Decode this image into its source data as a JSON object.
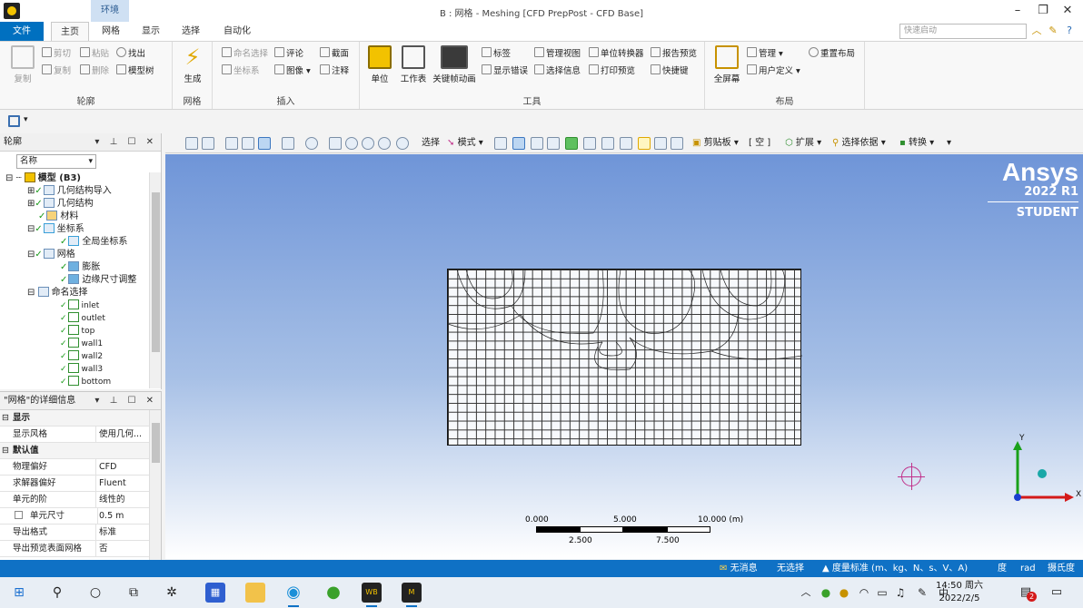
{
  "title_bar": {
    "context_tab": "环境",
    "window_title": "B : 网格 - Meshing [CFD PrepPost - CFD Base]",
    "minimize": "–",
    "maximize": "❐",
    "close": "✕"
  },
  "ribbon_tabs": {
    "file": "文件",
    "items": [
      "主页",
      "网格",
      "显示",
      "选择",
      "自动化"
    ],
    "quick_launch_placeholder": "快速启动"
  },
  "ribbon": {
    "outline_group": {
      "label": "轮廓",
      "copy": "复制",
      "cut": "剪切",
      "paste": "粘贴",
      "find": "找出",
      "duplicate": "复制",
      "delete": "删除",
      "tree": "模型树"
    },
    "mesh_group": {
      "label": "网格",
      "generate": "生成"
    },
    "insert_group": {
      "label": "插入",
      "named_selection": "命名选择",
      "comment": "评论",
      "section": "截面",
      "coordinate_system": "坐标系",
      "image": "图像",
      "annotation": "注释"
    },
    "tools_group": {
      "label": "工具",
      "units": "单位",
      "worksheet": "工作表",
      "keyframe": "关键帧动画",
      "tags": "标签",
      "show_errors": "显示错误",
      "manage_views": "管理视图",
      "selection_info": "选择信息",
      "unit_converter": "单位转换器",
      "print_preview": "打印预览",
      "report_preview": "报告预览",
      "shortcuts": "快捷键"
    },
    "layout_group": {
      "label": "布局",
      "fullscreen": "全屏幕",
      "manage": "管理",
      "user_defined": "用户定义",
      "reset_layout": "重置布局"
    }
  },
  "outline": {
    "title": "轮廓",
    "filter_value": "名称",
    "tree": [
      {
        "label": "模型 (B3)",
        "bold": true
      },
      {
        "label": "几何结构导入"
      },
      {
        "label": "几何结构"
      },
      {
        "label": "材料"
      },
      {
        "label": "坐标系"
      },
      {
        "label": "全局坐标系"
      },
      {
        "label": "网格"
      },
      {
        "label": "膨胀"
      },
      {
        "label": "边缘尺寸调整"
      },
      {
        "label": "命名选择"
      },
      {
        "label": "inlet"
      },
      {
        "label": "outlet"
      },
      {
        "label": "top"
      },
      {
        "label": "wall1"
      },
      {
        "label": "wall2"
      },
      {
        "label": "wall3"
      },
      {
        "label": "bottom"
      }
    ]
  },
  "details": {
    "title": "\"网格\"的详细信息",
    "sections": [
      {
        "name": "显示",
        "rows": [
          {
            "k": "显示风格",
            "v": "使用几何..."
          }
        ]
      },
      {
        "name": "默认值",
        "rows": [
          {
            "k": "物理偏好",
            "v": "CFD"
          },
          {
            "k": "求解器偏好",
            "v": "Fluent"
          },
          {
            "k": "单元的阶",
            "v": "线性的"
          },
          {
            "k": "单元尺寸",
            "v": "0.5 m",
            "checkbox": true
          },
          {
            "k": "导出格式",
            "v": "标准"
          },
          {
            "k": "导出预览表面网格",
            "v": "否"
          }
        ]
      }
    ]
  },
  "viewport_toolbar": {
    "select": "选择",
    "mode": "模式",
    "clipboard": "剪贴板",
    "empty": "[ 空 ]",
    "extend": "扩展",
    "select_by": "选择依据",
    "convert": "转换"
  },
  "viewport": {
    "brand": "Ansys",
    "version": "2022 R1",
    "edition": "STUDENT",
    "scale_labels_top": [
      "0.000",
      "5.000",
      "10.000 (m)"
    ],
    "scale_labels_bottom": [
      "2.500",
      "7.500"
    ],
    "axis_x": "X",
    "axis_y": "Y"
  },
  "status_bar": {
    "messages": "无消息",
    "selection": "无选择",
    "units": "度量标准 (m、kg、N、s、V、A)",
    "angle": "度",
    "rad": "rad",
    "temp": "摄氏度"
  },
  "taskbar": {
    "ime": "中",
    "time": "14:50 周六",
    "date": "2022/2/5",
    "notif_count": "2",
    "wb_label": "WB",
    "m_label": "M"
  },
  "colors": {
    "accent": "#0f71c5",
    "check_green": "#1a9a1a",
    "viewport_top": "#6f95d8"
  }
}
